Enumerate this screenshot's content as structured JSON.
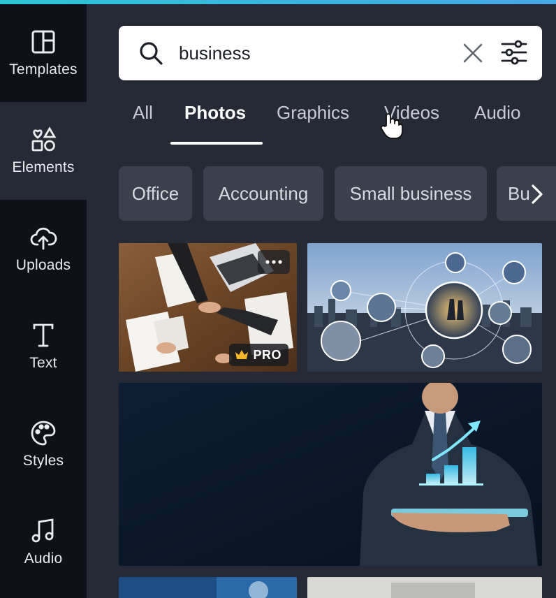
{
  "sidebar": {
    "items": [
      {
        "label": "Templates",
        "icon": "layout-template-icon"
      },
      {
        "label": "Elements",
        "icon": "shapes-icon"
      },
      {
        "label": "Uploads",
        "icon": "cloud-upload-icon"
      },
      {
        "label": "Text",
        "icon": "text-t-icon"
      },
      {
        "label": "Styles",
        "icon": "palette-icon"
      },
      {
        "label": "Audio",
        "icon": "music-note-icon"
      }
    ],
    "active": "Elements"
  },
  "search": {
    "value": "business",
    "icon": "search-icon",
    "clear_icon": "close-icon",
    "filter_icon": "filter-sliders-icon"
  },
  "tabs": [
    {
      "label": "All"
    },
    {
      "label": "Photos"
    },
    {
      "label": "Graphics"
    },
    {
      "label": "Videos"
    },
    {
      "label": "Audio"
    }
  ],
  "active_tab": "Photos",
  "chips": [
    {
      "label": "Office"
    },
    {
      "label": "Accounting"
    },
    {
      "label": "Small business"
    },
    {
      "label": "Bu"
    }
  ],
  "results": {
    "first": {
      "badge": "PRO",
      "badge_icon": "crown-icon",
      "more_icon": "more-dots-icon"
    }
  },
  "colors": {
    "sidebar_bg": "#0e1117",
    "panel_bg": "#252a35",
    "chip_bg": "#3a404c",
    "pro_crown": "#f5b72a"
  }
}
